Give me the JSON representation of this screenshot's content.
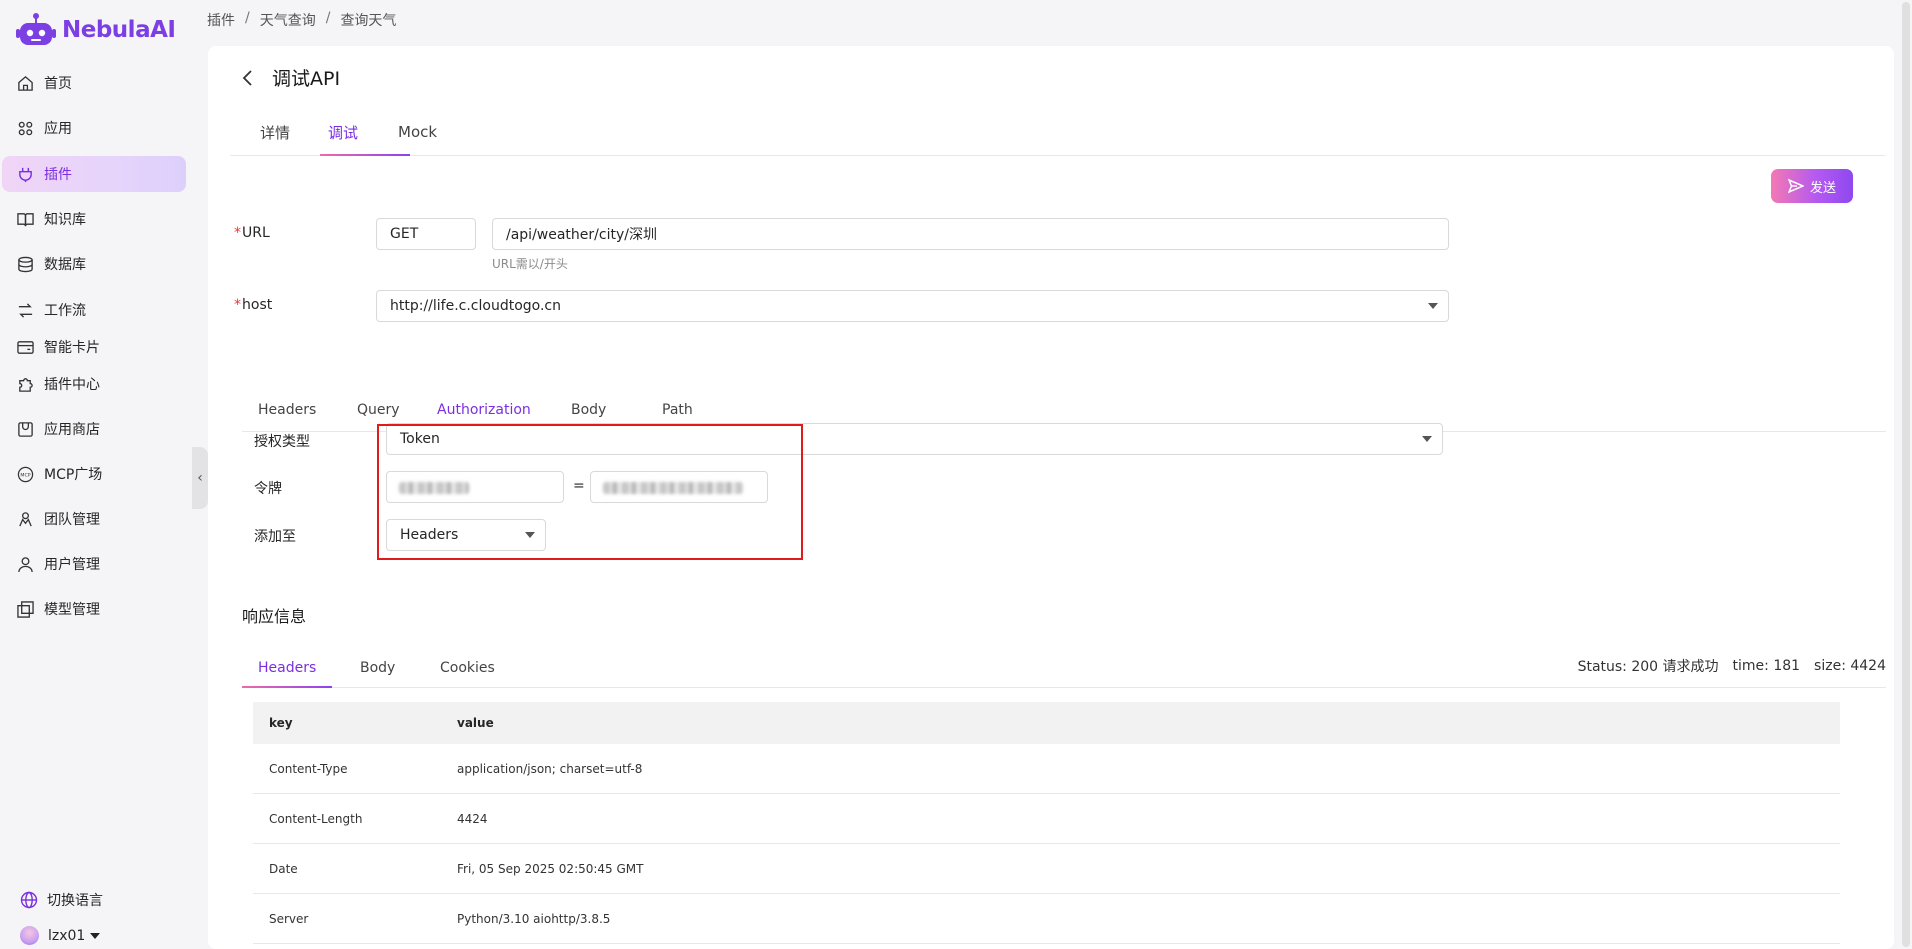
{
  "app": {
    "name": "NebulaAI"
  },
  "sidebar": {
    "items": [
      {
        "label": "首页",
        "icon": "home-icon"
      },
      {
        "label": "应用",
        "icon": "apps-icon"
      },
      {
        "label": "插件",
        "icon": "plug-icon",
        "active": true
      },
      {
        "label": "知识库",
        "icon": "book-icon"
      },
      {
        "label": "数据库",
        "icon": "database-icon"
      },
      {
        "label": "工作流",
        "icon": "workflow-icon"
      },
      {
        "label": "智能卡片",
        "icon": "card-icon"
      },
      {
        "label": "插件中心",
        "icon": "puzzle-icon"
      },
      {
        "label": "应用商店",
        "icon": "store-icon"
      },
      {
        "label": "MCP广场",
        "icon": "mcp-icon"
      },
      {
        "label": "团队管理",
        "icon": "team-icon"
      },
      {
        "label": "用户管理",
        "icon": "user-icon"
      },
      {
        "label": "模型管理",
        "icon": "model-icon"
      }
    ],
    "language_label": "切换语言",
    "username": "lzx01"
  },
  "breadcrumb": [
    "插件",
    "天气查询",
    "查询天气"
  ],
  "page": {
    "title": "调试API",
    "tabs": [
      "详情",
      "调试",
      "Mock"
    ],
    "active_tab": "调试",
    "send_label": "发送"
  },
  "form": {
    "url_label": "URL",
    "method": "GET",
    "url_value": "/api/weather/city/深圳",
    "url_hint": "URL需以/开头",
    "host_label": "host",
    "host_value": "http://life.c.cloudtogo.cn"
  },
  "request_tabs": [
    "Headers",
    "Query",
    "Authorization",
    "Body",
    "Path"
  ],
  "active_request_tab": "Authorization",
  "auth": {
    "type_label": "授权类型",
    "type_value": "Token",
    "token_label": "令牌",
    "equals": "=",
    "add_to_label": "添加至",
    "add_to_value": "Headers"
  },
  "response": {
    "title": "响应信息",
    "tabs": [
      "Headers",
      "Body",
      "Cookies"
    ],
    "active_tab": "Headers",
    "status": "Status: 200 请求成功",
    "time": "time: 181",
    "size": "size: 4424",
    "columns": [
      "key",
      "value"
    ],
    "rows": [
      {
        "key": "Content-Type",
        "value": "application/json; charset=utf-8"
      },
      {
        "key": "Content-Length",
        "value": "4424"
      },
      {
        "key": "Date",
        "value": "Fri, 05 Sep 2025 02:50:45 GMT"
      },
      {
        "key": "Server",
        "value": "Python/3.10 aiohttp/3.8.5"
      }
    ]
  },
  "colors": {
    "accent": "#7b2fe0",
    "required": "#e53935",
    "highlight_box": "#e01b1b"
  }
}
